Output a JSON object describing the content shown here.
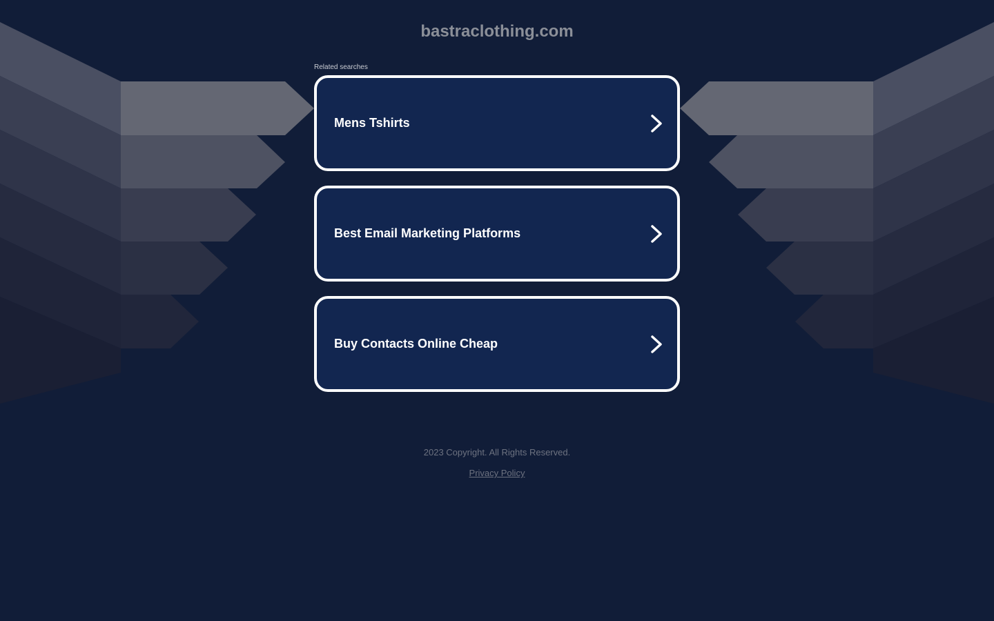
{
  "site": {
    "title": "bastraclothing.com"
  },
  "related": {
    "label": "Related searches",
    "items": [
      {
        "label": "Mens Tshirts",
        "icon": "chevron-right-icon"
      },
      {
        "label": "Best Email Marketing Platforms",
        "icon": "chevron-right-icon"
      },
      {
        "label": "Buy Contacts Online Cheap",
        "icon": "chevron-right-icon"
      }
    ]
  },
  "footer": {
    "copyright": "2023 Copyright. All Rights Reserved.",
    "privacy_label": "Privacy Policy"
  },
  "colors": {
    "background": "#111d38",
    "card_fill": "#122650",
    "card_border": "#ffffff",
    "title_text": "#8b8f98",
    "footer_text": "#6d7280"
  }
}
